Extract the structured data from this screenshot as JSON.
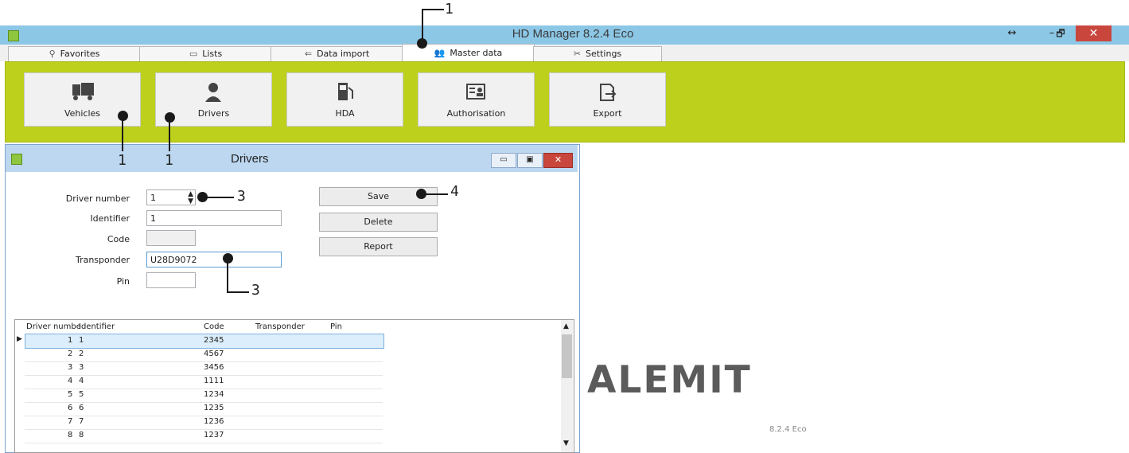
{
  "app": {
    "title": "HD Manager 8.2.4  Eco",
    "resize_glyph": "↔",
    "minimize": "–",
    "restore": "🗗",
    "close": "✕"
  },
  "tabs": [
    {
      "label": "Favorites",
      "icon": "pin-icon"
    },
    {
      "label": "Lists",
      "icon": "list-icon"
    },
    {
      "label": "Data import",
      "icon": "import-icon"
    },
    {
      "label": "Master data",
      "icon": "users-icon",
      "active": true
    },
    {
      "label": "Settings",
      "icon": "tools-icon"
    }
  ],
  "ribbon": {
    "accent_color": "#bdd01c",
    "buttons": [
      {
        "label": "Vehicles",
        "icon": "truck-icon"
      },
      {
        "label": "Drivers",
        "icon": "person-icon"
      },
      {
        "label": "HDA",
        "icon": "fuel-pump-icon"
      },
      {
        "label": "Authorisation",
        "icon": "id-card-icon"
      },
      {
        "label": "Export",
        "icon": "export-icon"
      }
    ]
  },
  "dialog": {
    "title": "Drivers",
    "fields": {
      "driver_number": {
        "label": "Driver number",
        "value": "1"
      },
      "identifier": {
        "label": "Identifier",
        "value": "1"
      },
      "code": {
        "label": "Code",
        "value": ""
      },
      "transponder": {
        "label": "Transponder",
        "value": "U28D9072"
      },
      "pin": {
        "label": "Pin",
        "value": ""
      }
    },
    "buttons": {
      "save": "Save",
      "delete": "Delete",
      "report": "Report"
    },
    "grid": {
      "columns": [
        "Driver numbe",
        "Identifier",
        "Code",
        "Transponder",
        "Pin"
      ],
      "rows": [
        {
          "num": "1",
          "id": "1",
          "code": "2345",
          "transponder": "",
          "pin": ""
        },
        {
          "num": "2",
          "id": "2",
          "code": "4567",
          "transponder": "",
          "pin": ""
        },
        {
          "num": "3",
          "id": "3",
          "code": "3456",
          "transponder": "",
          "pin": ""
        },
        {
          "num": "4",
          "id": "4",
          "code": "1111",
          "transponder": "",
          "pin": ""
        },
        {
          "num": "5",
          "id": "5",
          "code": "1234",
          "transponder": "",
          "pin": ""
        },
        {
          "num": "6",
          "id": "6",
          "code": "1235",
          "transponder": "",
          "pin": ""
        },
        {
          "num": "7",
          "id": "7",
          "code": "1236",
          "transponder": "",
          "pin": ""
        },
        {
          "num": "8",
          "id": "8",
          "code": "1237",
          "transponder": "",
          "pin": ""
        }
      ]
    }
  },
  "callouts": {
    "c1": "1",
    "c2": "1",
    "c3": "1",
    "c4": "3",
    "c5": "4",
    "c6": "3"
  },
  "brand": {
    "text": "ALEMIT",
    "version": "8.2.4 Eco"
  }
}
